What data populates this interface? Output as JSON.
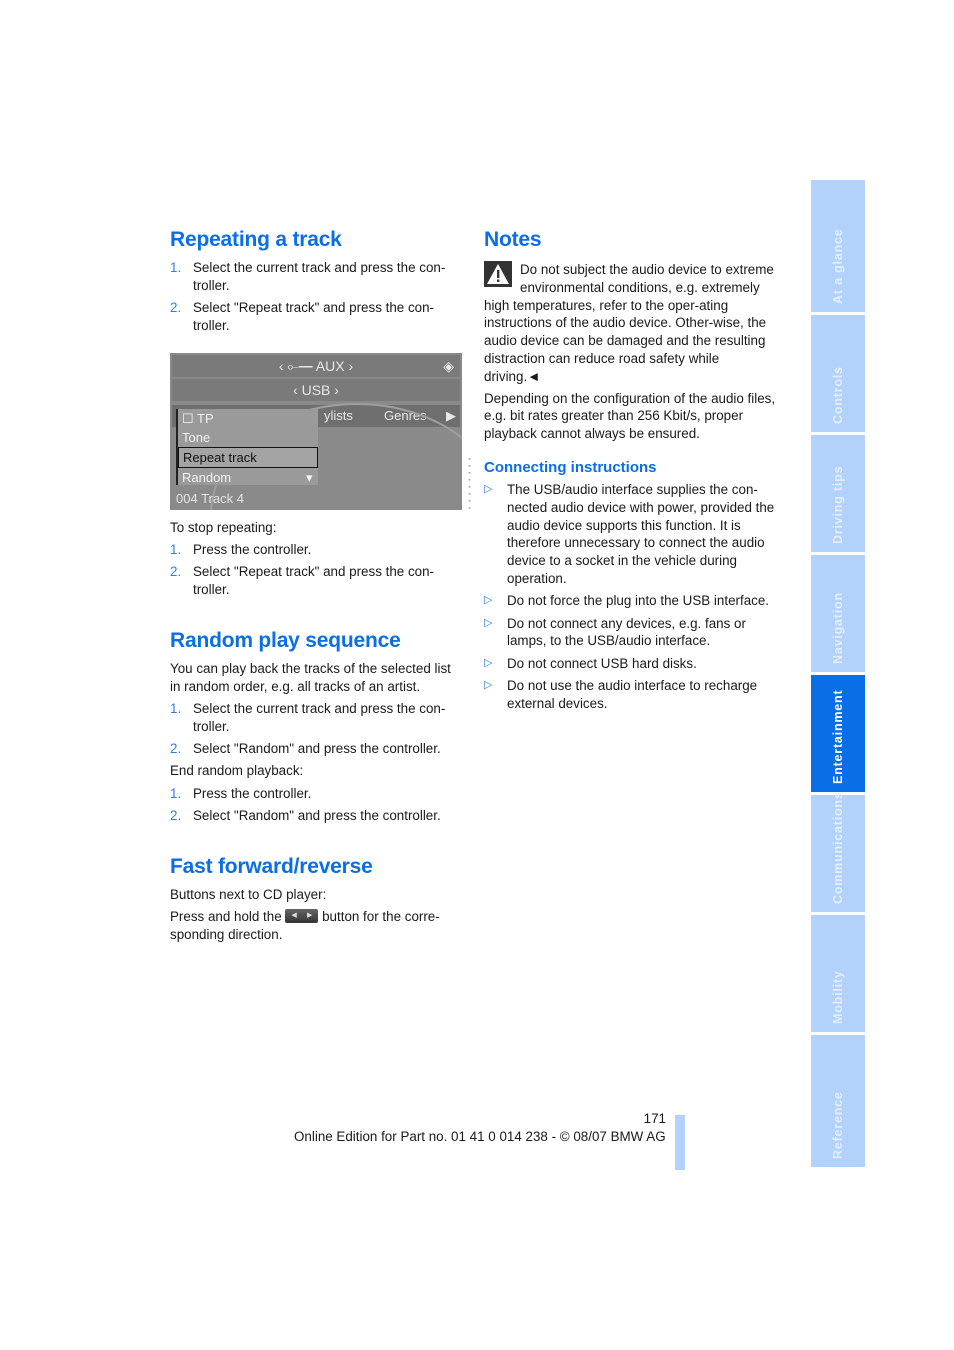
{
  "left": {
    "repeat": {
      "heading": "Repeating a track",
      "steps": [
        {
          "num": "1.",
          "text": "Select the current track and press the con-troller."
        },
        {
          "num": "2.",
          "text": "Select \"Repeat track\" and press the con-troller."
        }
      ],
      "screen": {
        "row1": "AUX",
        "row2": "USB",
        "tabs": [
          "ylists",
          "Genres"
        ],
        "menu": [
          "TP",
          "Tone",
          "Repeat track",
          "Random"
        ],
        "selected": "Repeat track",
        "track": "004 Track 4"
      },
      "stop_intro": "To stop repeating:",
      "stop_steps": [
        {
          "num": "1.",
          "text": "Press the controller."
        },
        {
          "num": "2.",
          "text": "Select \"Repeat track\" and press the con-troller."
        }
      ]
    },
    "random": {
      "heading": "Random play sequence",
      "intro": "You can play back the tracks of the selected list in random order, e.g. all tracks of an artist.",
      "steps": [
        {
          "num": "1.",
          "text": "Select the current track and press the con-troller."
        },
        {
          "num": "2.",
          "text": "Select \"Random\" and press the controller."
        }
      ],
      "end_intro": "End random playback:",
      "end_steps": [
        {
          "num": "1.",
          "text": "Press the controller."
        },
        {
          "num": "2.",
          "text": "Select \"Random\" and press the controller."
        }
      ]
    },
    "ffwd": {
      "heading": "Fast forward/reverse",
      "p1": "Buttons next to CD player:",
      "p2_before": "Press and hold the ",
      "p2_after": " button for the corre-sponding direction."
    }
  },
  "right": {
    "notes_heading": "Notes",
    "warning": "Do not subject the audio device to extreme environmental conditions, e.g. extremely high temperatures, refer to the oper-ating instructions of the audio device. Other-wise, the audio device can be damaged and the resulting distraction can reduce road safety while driving.◄",
    "para": "Depending on the configuration of the audio files, e.g. bit rates greater than 256 Kbit/s, proper playback cannot always be ensured.",
    "connecting_heading": "Connecting instructions",
    "bullets": [
      "The USB/audio interface supplies the con-nected audio device with power, provided the audio device supports this function. It is therefore unnecessary to connect the audio device to a socket in the vehicle during operation.",
      "Do not force the plug into the USB interface.",
      "Do not connect any devices, e.g. fans or lamps, to the USB/audio interface.",
      "Do not connect USB hard disks.",
      "Do not use the audio interface to recharge external devices."
    ]
  },
  "sidebar": {
    "tabs": [
      "At a glance",
      "Controls",
      "Driving tips",
      "Navigation",
      "Entertainment",
      "Communications",
      "Mobility",
      "Reference"
    ],
    "active": "Entertainment",
    "accent": "#0a6ee6",
    "inactive_color": "#b3d2fb"
  },
  "footer": {
    "page_number": "171",
    "text": "Online Edition for Part no. 01 41 0 014 238 - © 08/07 BMW AG"
  }
}
